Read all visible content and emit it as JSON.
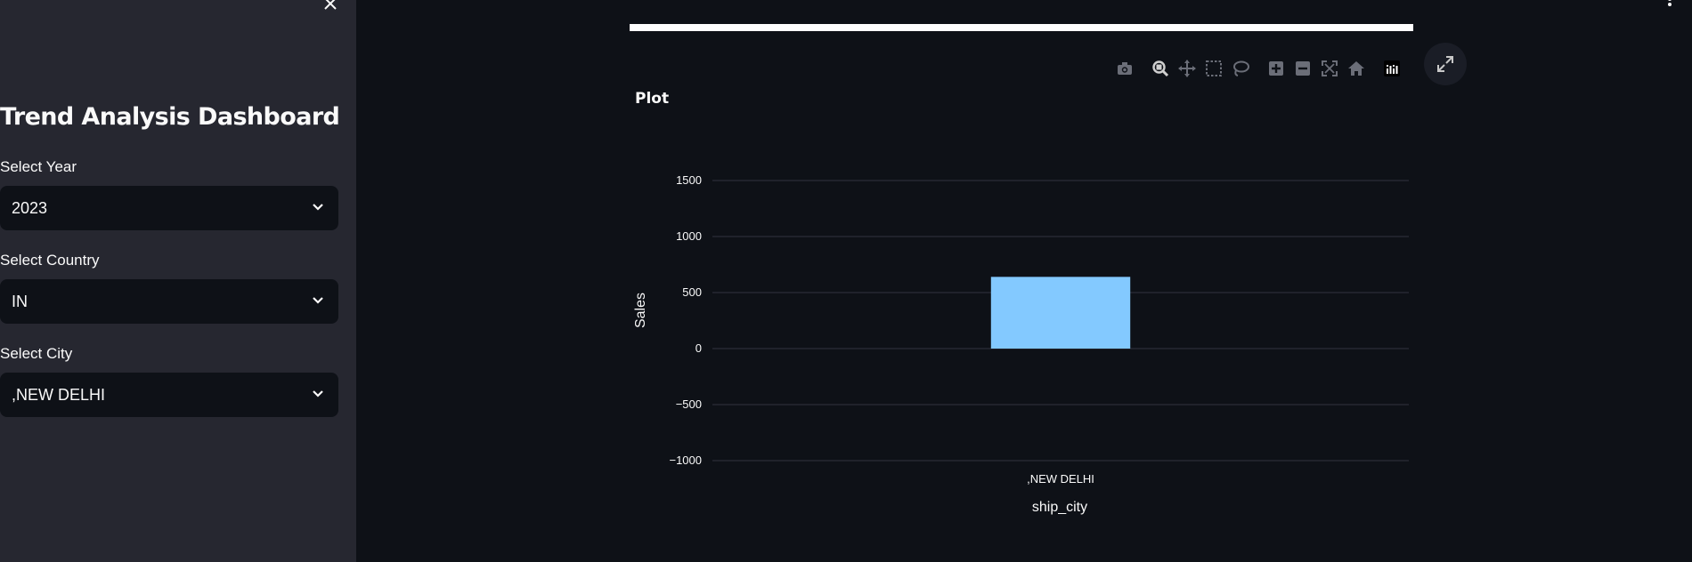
{
  "sidebar": {
    "close_icon": "close-icon",
    "title": "Trend Analysis Dashboard",
    "fields": [
      {
        "label": "Select Year",
        "value": "2023"
      },
      {
        "label": "Select Country",
        "value": "IN"
      },
      {
        "label": "Select City",
        "value": ",NEW DELHI"
      }
    ]
  },
  "modebar": {
    "icons": [
      "camera-icon",
      "zoom-icon",
      "pan-icon",
      "box-select-icon",
      "lasso-select-icon",
      "zoom-in-icon",
      "zoom-out-icon",
      "autoscale-icon",
      "reset-axes-icon",
      "plotly-logo-icon"
    ]
  },
  "colors": {
    "sidebar_bg": "#262730",
    "main_bg": "#0e1117",
    "bar": "#83c9ff",
    "grid": "#31333f"
  },
  "chart_data": {
    "type": "bar",
    "title": "Plot",
    "xlabel": "ship_city",
    "ylabel": "Sales",
    "categories": [
      ",NEW DELHI"
    ],
    "values": [
      640
    ],
    "ylim": [
      -1150,
      1700
    ],
    "yticks": [
      1500,
      1000,
      500,
      0,
      -500,
      -1000
    ],
    "ytick_labels": [
      "1500",
      "1000",
      "500",
      "0",
      "−500",
      "−1000"
    ],
    "grid": true
  }
}
